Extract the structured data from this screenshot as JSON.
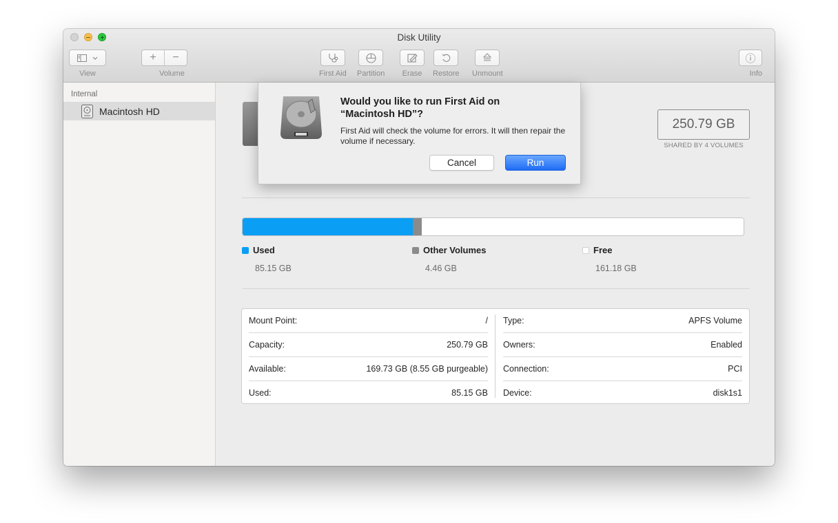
{
  "window": {
    "title": "Disk Utility"
  },
  "toolbar": {
    "view_label": "View",
    "volume_label": "Volume",
    "first_aid_label": "First Aid",
    "partition_label": "Partition",
    "erase_label": "Erase",
    "restore_label": "Restore",
    "unmount_label": "Unmount",
    "info_label": "Info",
    "add_glyph": "+",
    "remove_glyph": "−",
    "info_glyph": "ⓘ"
  },
  "sidebar": {
    "section": "Internal",
    "items": [
      {
        "label": "Macintosh HD",
        "icon": "internal-disk-icon",
        "selected": true
      }
    ]
  },
  "volume": {
    "capacity": "250.79 GB",
    "capacity_sub": "SHARED BY 4 VOLUMES"
  },
  "storage": {
    "used": {
      "label": "Used",
      "value": "85.15 GB",
      "gb": 85.15,
      "color": "#0a9ff5"
    },
    "other": {
      "label": "Other Volumes",
      "value": "4.46 GB",
      "gb": 4.46,
      "color": "#8b8b8b"
    },
    "free": {
      "label": "Free",
      "value": "161.18 GB",
      "gb": 161.18,
      "color": "#ffffff"
    },
    "total_gb": 250.79
  },
  "info": {
    "left": [
      {
        "label": "Mount Point:",
        "value": "/"
      },
      {
        "label": "Capacity:",
        "value": "250.79 GB"
      },
      {
        "label": "Available:",
        "value": "169.73 GB (8.55 GB purgeable)"
      },
      {
        "label": "Used:",
        "value": "85.15 GB"
      }
    ],
    "right": [
      {
        "label": "Type:",
        "value": "APFS Volume"
      },
      {
        "label": "Owners:",
        "value": "Enabled"
      },
      {
        "label": "Connection:",
        "value": "PCI"
      },
      {
        "label": "Device:",
        "value": "disk1s1"
      }
    ]
  },
  "dialog": {
    "title": "Would you like to run First Aid on “Macintosh HD”?",
    "body": "First Aid will check the volume for errors. It will then repair the volume if necessary.",
    "cancel_label": "Cancel",
    "run_label": "Run"
  },
  "colors": {
    "accent": "#1f6cf5",
    "used": "#0a9ff5",
    "other": "#8b8b8b"
  }
}
